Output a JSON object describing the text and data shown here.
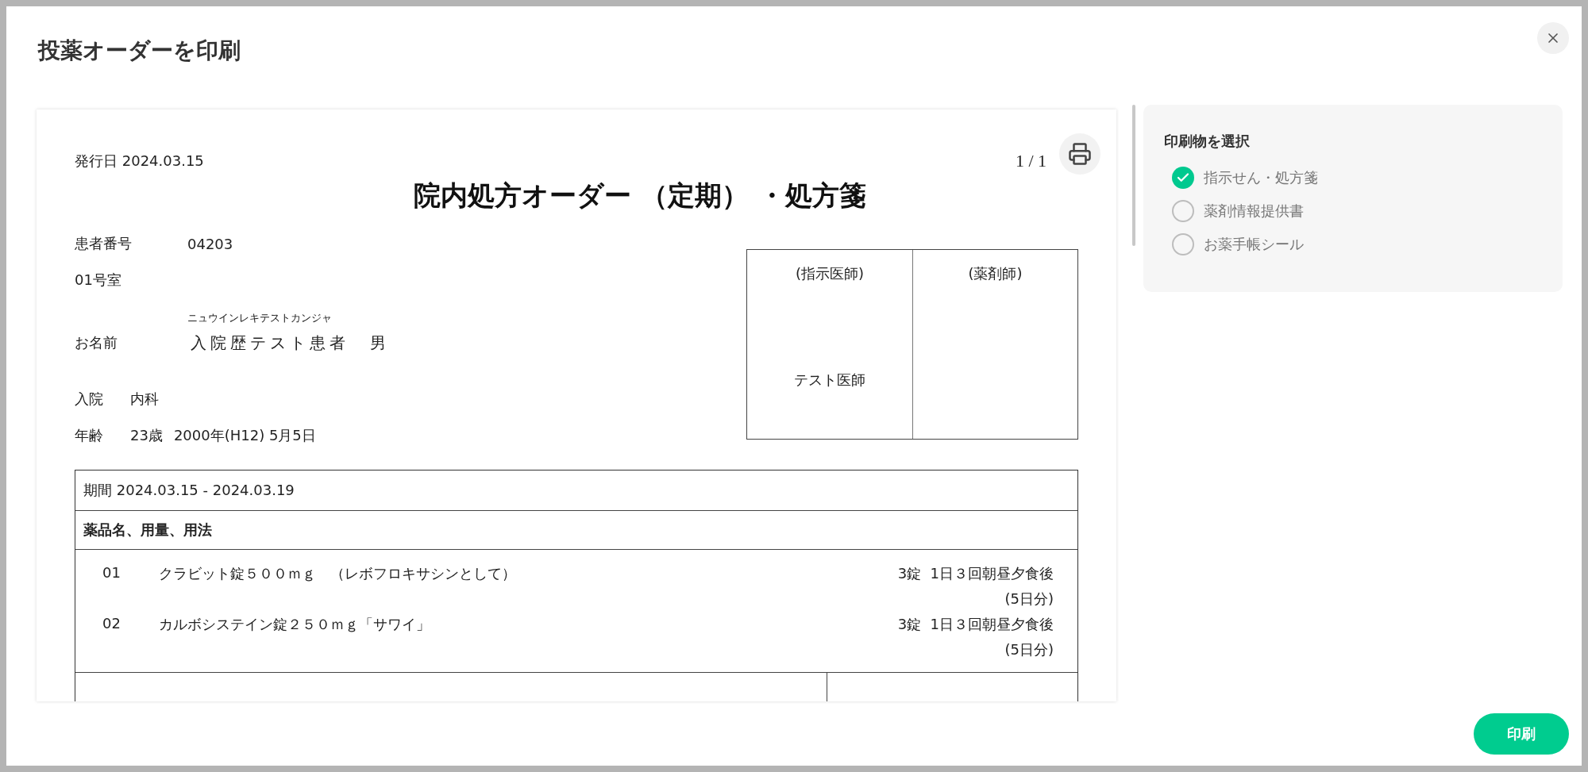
{
  "dialog": {
    "title": "投薬オーダーを印刷"
  },
  "document": {
    "issue_date": "発行日 2024.03.15",
    "page": "1 / 1",
    "title": "院内処方オーダー （定期） ・処方箋",
    "patient_number": {
      "label": "患者番号",
      "value": "04203"
    },
    "room": "01号室",
    "name": {
      "furigana": "ニュウインレキテストカンジャ",
      "label": "お名前",
      "value": "入院歴テスト患者",
      "sex": "男"
    },
    "admission": {
      "label": "入院",
      "value": "内科"
    },
    "age": {
      "label": "年齢",
      "value": "23歳",
      "birthdate": "2000年(H12) 5月5日"
    },
    "signatures": [
      {
        "heading": "(指示医師)",
        "name": "テスト医師"
      },
      {
        "heading": "(薬剤師)"
      }
    ],
    "prescription": {
      "period": "期間 2024.03.15 - 2024.03.19",
      "header": "薬品名、用量、用法",
      "items": [
        {
          "number": "01",
          "drug": "クラビット錠５００ｍｇ　（レボフロキサシンとして）",
          "dosage": "3錠  1日３回朝昼夕食後",
          "days": "(5日分)"
        },
        {
          "number": "02",
          "drug": "カルボシステイン錠２５０ｍｇ「サワイ」",
          "dosage": "3錠  1日３回朝昼夕食後",
          "days": "(5日分)"
        }
      ]
    }
  },
  "print_options": {
    "title": "印刷物を選択",
    "options": [
      {
        "label": "指示せん・処方箋",
        "selected": true
      },
      {
        "label": "薬剤情報提供書",
        "selected": false
      },
      {
        "label": "お薬手帳シール",
        "selected": false
      }
    ]
  },
  "print_button": "印刷"
}
